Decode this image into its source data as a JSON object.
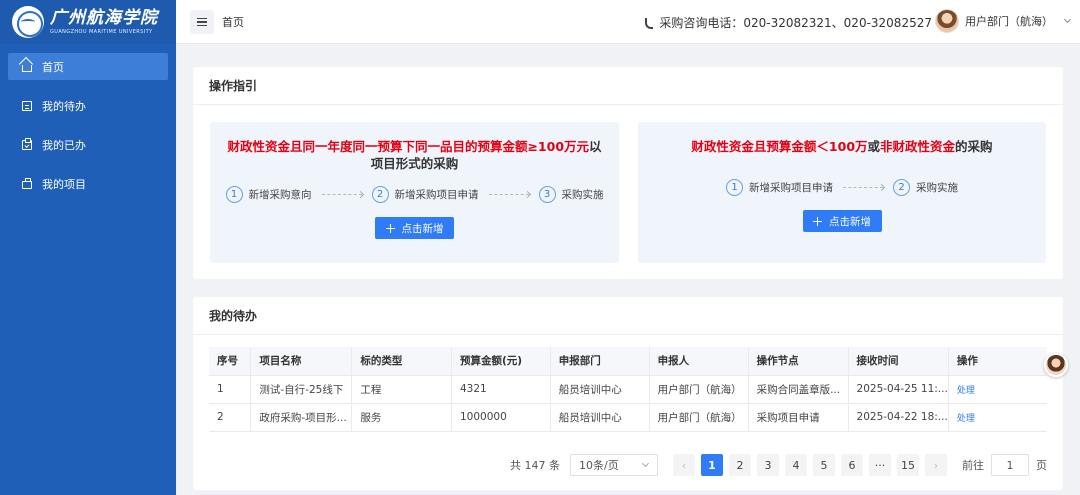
{
  "sidebar": {
    "logo_cn": "广州航海学院",
    "logo_en": "GUANGZHOU MARITIME UNIVERSITY",
    "items": [
      {
        "label": "首页",
        "icon": "home-icon",
        "active": true
      },
      {
        "label": "我的待办",
        "icon": "document-icon"
      },
      {
        "label": "我的已办",
        "icon": "clipboard-check-icon"
      },
      {
        "label": "我的项目",
        "icon": "briefcase-icon"
      }
    ]
  },
  "header": {
    "breadcrumb": "首页",
    "hotline": "采购咨询电话：020-32082321、020-32082527",
    "username": "用户部门（航海）"
  },
  "guide": {
    "title": "操作指引",
    "left": {
      "title_red": "财政性资金且同一年度同一预算下同一品目的预算金额≥100万元",
      "title_rest": "以项目形式的采购",
      "steps": [
        {
          "num": "1",
          "label": "新增采购意向"
        },
        {
          "num": "2",
          "label": "新增采购项目申请"
        },
        {
          "num": "3",
          "label": "采购实施"
        }
      ],
      "button": "点击新增"
    },
    "right": {
      "title_red_1": "财政性资金且预算金额＜100万",
      "title_mid": "或",
      "title_red_2": "非财政性资金",
      "title_rest": "的采购",
      "steps": [
        {
          "num": "1",
          "label": "新增采购项目申请"
        },
        {
          "num": "2",
          "label": "采购实施"
        }
      ],
      "button": "点击新增"
    }
  },
  "todo": {
    "title": "我的待办",
    "columns": [
      "序号",
      "项目名称",
      "标的类型",
      "预算金额(元)",
      "申报部门",
      "申报人",
      "操作节点",
      "接收时间",
      "操作"
    ],
    "rows": [
      [
        "1",
        "测试-自行-25线下",
        "工程",
        "4321",
        "船员培训中心",
        "用户部门（航海）",
        "采购合同盖章版...",
        "2025-04-25 11:...",
        "处理"
      ],
      [
        "2",
        "政府采购-项目形...",
        "服务",
        "1000000",
        "船员培训中心",
        "用户部门（航海）",
        "采购项目申请",
        "2025-04-22 18:...",
        "处理"
      ]
    ],
    "pagination": {
      "total": "共 147 条",
      "page_size": "10条/页",
      "pages": [
        "1",
        "2",
        "3",
        "4",
        "5",
        "6"
      ],
      "ellipsis": "···",
      "last_page": "15",
      "current": "1",
      "goto_label": "前往",
      "goto_value": "1",
      "goto_suffix": "页"
    }
  }
}
